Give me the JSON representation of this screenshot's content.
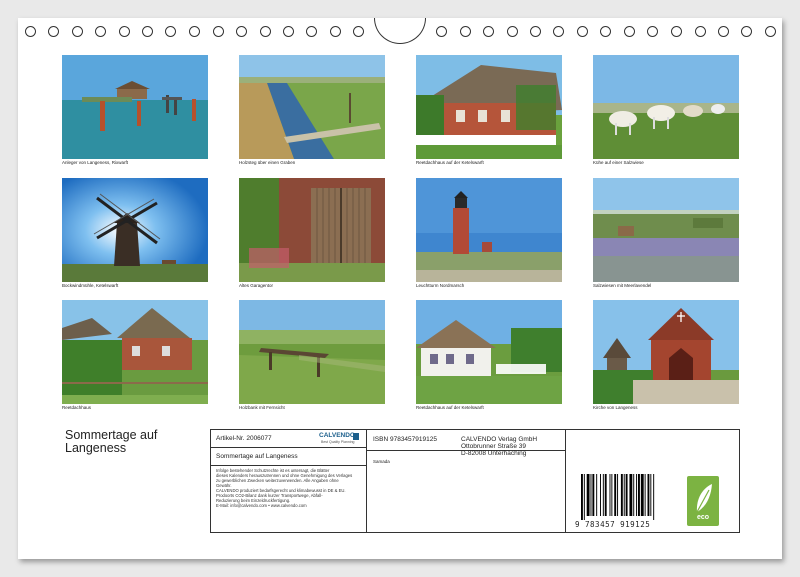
{
  "calendar": {
    "title": "Sommertage auf Langeness",
    "photos": [
      {
        "caption": "Anleger von Langeness, Rixwarft",
        "scene": "harbor"
      },
      {
        "caption": "Holzsteg über einen Graben",
        "scene": "ditch"
      },
      {
        "caption": "Reetdachhaus auf der Ketelswarft",
        "scene": "farmhouse"
      },
      {
        "caption": "Kühe auf einer Salzwiese",
        "scene": "cows"
      },
      {
        "caption": "Bockwindmühle, Ketelswarft",
        "scene": "windmill"
      },
      {
        "caption": "Altes Garagentor",
        "scene": "gate"
      },
      {
        "caption": "Leuchtturm Nordmarsch",
        "scene": "lighthouse"
      },
      {
        "caption": "Salzwiesen mit Meerlavendel",
        "scene": "saltmarsh"
      },
      {
        "caption": "Reetdachhaus",
        "scene": "thatched"
      },
      {
        "caption": "Holzbank mit Fernsicht",
        "scene": "bench"
      },
      {
        "caption": "Reetdachhaus auf der Ketelswarft",
        "scene": "whitehouse"
      },
      {
        "caption": "Kirche von Langeness",
        "scene": "church"
      }
    ]
  },
  "info_box": {
    "article": "Artikel-Nr. 2006077",
    "logo": "CALVENDO",
    "logo_sub": "Best Quality Planning",
    "product_title": "Sommertage auf Langeness",
    "legal_1": "Infolge bestehender Schutzrechte ist es untersagt, die Blätter",
    "legal_2": "dieses Kalenders herauszutrennen und ohne Genehmigung des Verlages",
    "legal_3": "zu gewerblichen Zwecken weiterzuverwenden. Alle Angaben ohne",
    "legal_4": "Gewähr.",
    "legal_5": "CALVENDO produziert bedarfsgerecht und klimabewusst in DE & EU.",
    "legal_6": "Prodoorts CO2-Bilanz dank kurzer Transportwege, Abfall-",
    "legal_7": "Reduzierung beim Einzeldruckfertigung.",
    "email": "E-Mail: info@calvendo.com • www.calvendo.com",
    "isbn": "ISBN 9783457919125",
    "publisher_line1": "CALVENDO Verlag GmbH",
    "publisher_line2": "Ottobrunner Straße 39",
    "publisher_line3": "D-82008 Unterhaching",
    "small_label": "Samada",
    "barcode_digits": "9 783457 919125",
    "eco_label": "eco",
    "eco_color": "#7cb342"
  }
}
